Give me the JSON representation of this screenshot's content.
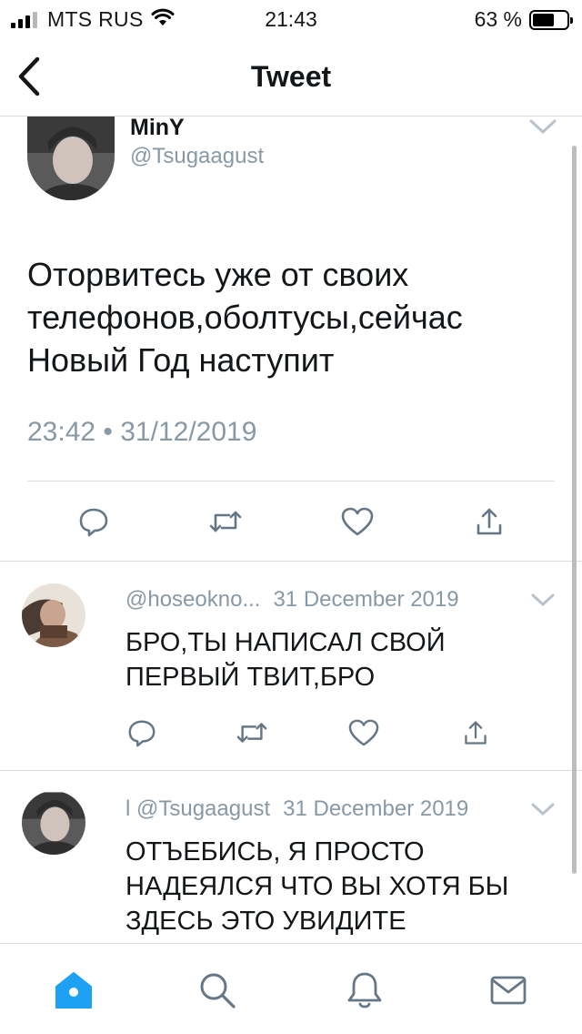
{
  "status_bar": {
    "carrier": "MTS RUS",
    "time": "21:43",
    "battery_text": "63 %",
    "battery_level": 0.63
  },
  "nav": {
    "title": "Tweet"
  },
  "tweet": {
    "author_name": "MinY",
    "author_handle": "@Tsugaagust",
    "text_lines": [
      "Оторвитесь уже от своих",
      "телефонов,оболтусы,сейчас",
      "Новый Год наступит"
    ],
    "timestamp": "23:42 • 31/12/2019"
  },
  "replies": [
    {
      "handle": "@hoseokno...",
      "date": "31 December 2019",
      "text_lines": [
        "БРО,ТЫ НАПИСАЛ СВОЙ",
        "ПЕРВЫЙ ТВИТ,БРО"
      ]
    },
    {
      "handle": "l @Tsugaagust",
      "date": "31 December 2019",
      "text_lines": [
        "ОТЪЕБИСЬ, Я ПРОСТО",
        "НАДЕЯЛСЯ ЧТО ВЫ ХОТЯ БЫ",
        "ЗДЕСЬ ЭТО УВИДИТЕ"
      ]
    }
  ],
  "icons": {
    "back": "chevron-left-icon",
    "more": "chevron-down-icon",
    "reply": "reply-icon",
    "retweet": "retweet-icon",
    "like": "heart-icon",
    "share": "share-icon",
    "home": "home-icon",
    "search": "search-icon",
    "notifications": "bell-icon",
    "messages": "mail-icon"
  },
  "colors": {
    "accent": "#1da1f2",
    "secondary_text": "#8899a6",
    "icon_gray": "#657786"
  }
}
